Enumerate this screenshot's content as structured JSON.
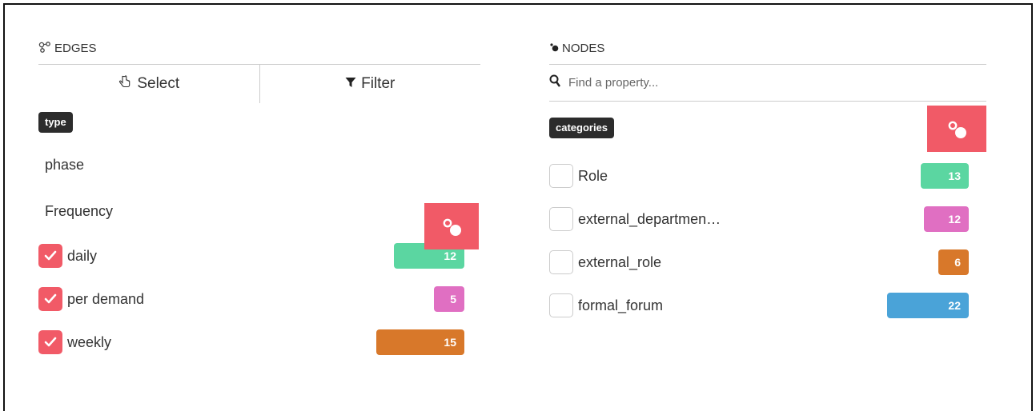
{
  "edges": {
    "title": "EDGES",
    "title_icon": "edges-icon",
    "toolbar": {
      "select_label": "Select",
      "filter_label": "Filter"
    },
    "type_tag": "type",
    "attributes": [
      "phase",
      "Frequency"
    ],
    "color_button_icon": "palette-icon",
    "items": [
      {
        "label": "daily",
        "count": "12",
        "checked": true,
        "color": "#5bd6a1",
        "fraction": 0.8
      },
      {
        "label": "per demand",
        "count": "5",
        "checked": true,
        "color": "#e06fc2",
        "fraction": 0.333
      },
      {
        "label": "weekly",
        "count": "15",
        "checked": true,
        "color": "#d8782a",
        "fraction": 1.0
      }
    ]
  },
  "nodes": {
    "title": "NODES",
    "title_icon": "nodes-icon",
    "search": {
      "placeholder": "Find a property...",
      "value": ""
    },
    "category_tag": "categories",
    "color_button_icon": "palette-icon",
    "items": [
      {
        "label": "Role",
        "count": "13",
        "checked": false,
        "color": "#5bd6a1",
        "fraction": 0.591
      },
      {
        "label": "external_departmen…",
        "count": "12",
        "checked": false,
        "color": "#e06fc2",
        "fraction": 0.545
      },
      {
        "label": "external_role",
        "count": "6",
        "checked": false,
        "color": "#d8782a",
        "fraction": 0.273
      },
      {
        "label": "formal_forum",
        "count": "22",
        "checked": false,
        "color": "#4aa3d8",
        "fraction": 1.0
      }
    ]
  }
}
